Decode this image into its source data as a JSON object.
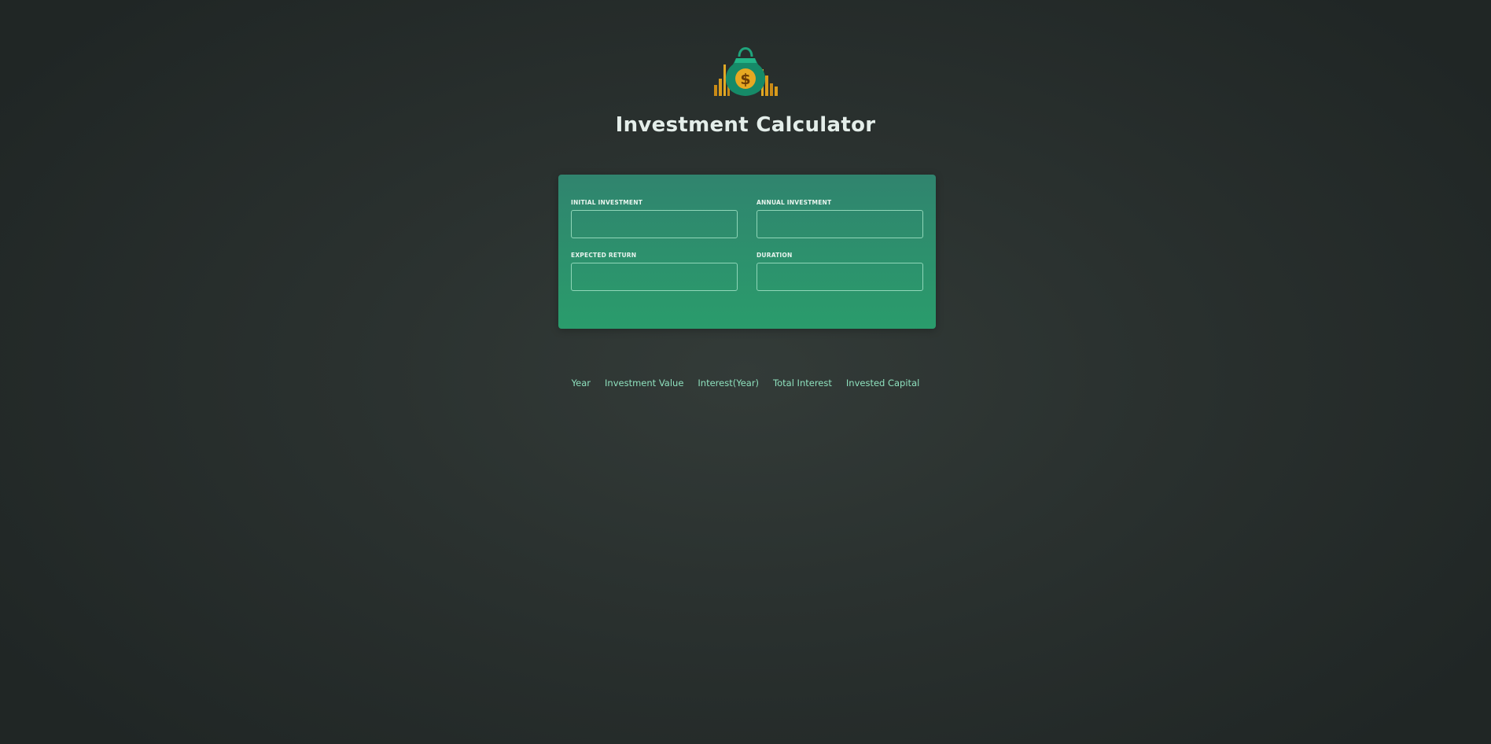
{
  "header": {
    "logo_icon": "money-bag-icon",
    "title": "Investment Calculator"
  },
  "inputs": {
    "initial_investment": {
      "label": "Initial Investment",
      "value": ""
    },
    "annual_investment": {
      "label": "Annual Investment",
      "value": ""
    },
    "expected_return": {
      "label": "Expected Return",
      "value": ""
    },
    "duration": {
      "label": "Duration",
      "value": ""
    }
  },
  "results": {
    "columns": [
      "Year",
      "Investment Value",
      "Interest(Year)",
      "Total Interest",
      "Invested Capital"
    ]
  },
  "colors": {
    "accent_text": "#8ee0bd",
    "panel_top": "#30846e",
    "panel_bottom": "#2a9c6c",
    "background": "#2a312f"
  }
}
